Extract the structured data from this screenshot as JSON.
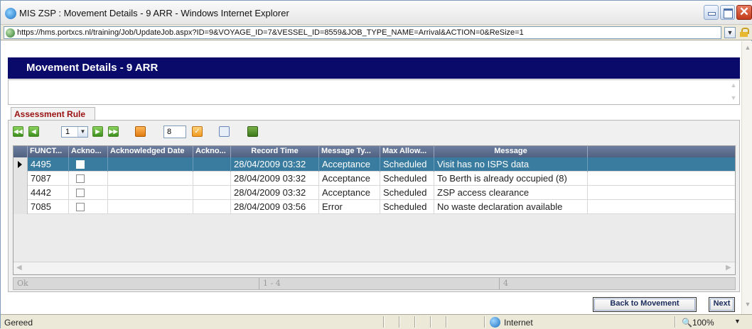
{
  "window": {
    "title": "MIS ZSP : Movement Details - 9 ARR - Windows Internet Explorer",
    "icon": "ie-icon"
  },
  "address_bar": {
    "url": "https://hms.portxcs.nl/training/Job/UpdateJob.aspx?ID=9&VOYAGE_ID=7&VESSEL_ID=8559&JOB_TYPE_NAME=Arrival&ACTION=0&ReSize=1"
  },
  "page": {
    "header_title": "Movement Details - 9 ARR",
    "tab_label": "Assessment Rule",
    "accent_color": "#0a0a6a",
    "selected_row_color": "#3a7ca0",
    "tab_text_color": "#9a1010"
  },
  "toolbar": {
    "page_select_value": "1",
    "page_size_value": "8"
  },
  "grid": {
    "columns": [
      "FUNCT...",
      "Ackno...",
      "Acknowledged Date",
      "Ackno...",
      "Record Time",
      "Message Ty...",
      "Max Allow...",
      "Message"
    ],
    "rows": [
      {
        "funct": "4495",
        "ack": false,
        "ack_date": "",
        "ack2": "",
        "record_time": "28/04/2009 03:32",
        "message_type": "Acceptance",
        "max_allowed": "Scheduled",
        "message": "Visit has no ISPS data",
        "selected": true
      },
      {
        "funct": "7087",
        "ack": false,
        "ack_date": "",
        "ack2": "",
        "record_time": "28/04/2009 03:32",
        "message_type": "Acceptance",
        "max_allowed": "Scheduled",
        "message": "To Berth is already occupied (8)",
        "selected": false
      },
      {
        "funct": "4442",
        "ack": false,
        "ack_date": "",
        "ack2": "",
        "record_time": "28/04/2009 03:32",
        "message_type": "Acceptance",
        "max_allowed": "Scheduled",
        "message": "ZSP access clearance",
        "selected": false
      },
      {
        "funct": "7085",
        "ack": false,
        "ack_date": "",
        "ack2": "",
        "record_time": "28/04/2009 03:56",
        "message_type": "Error",
        "max_allowed": "Scheduled",
        "message": "No waste declaration available",
        "selected": false
      }
    ],
    "footer": {
      "status": "Ok",
      "range": "1 - 4",
      "count": "4"
    }
  },
  "buttons": {
    "back": "Back to Movement",
    "next": "Next"
  },
  "status_bar": {
    "status_text": "Gereed",
    "zone": "Internet",
    "zoom": "100%"
  }
}
